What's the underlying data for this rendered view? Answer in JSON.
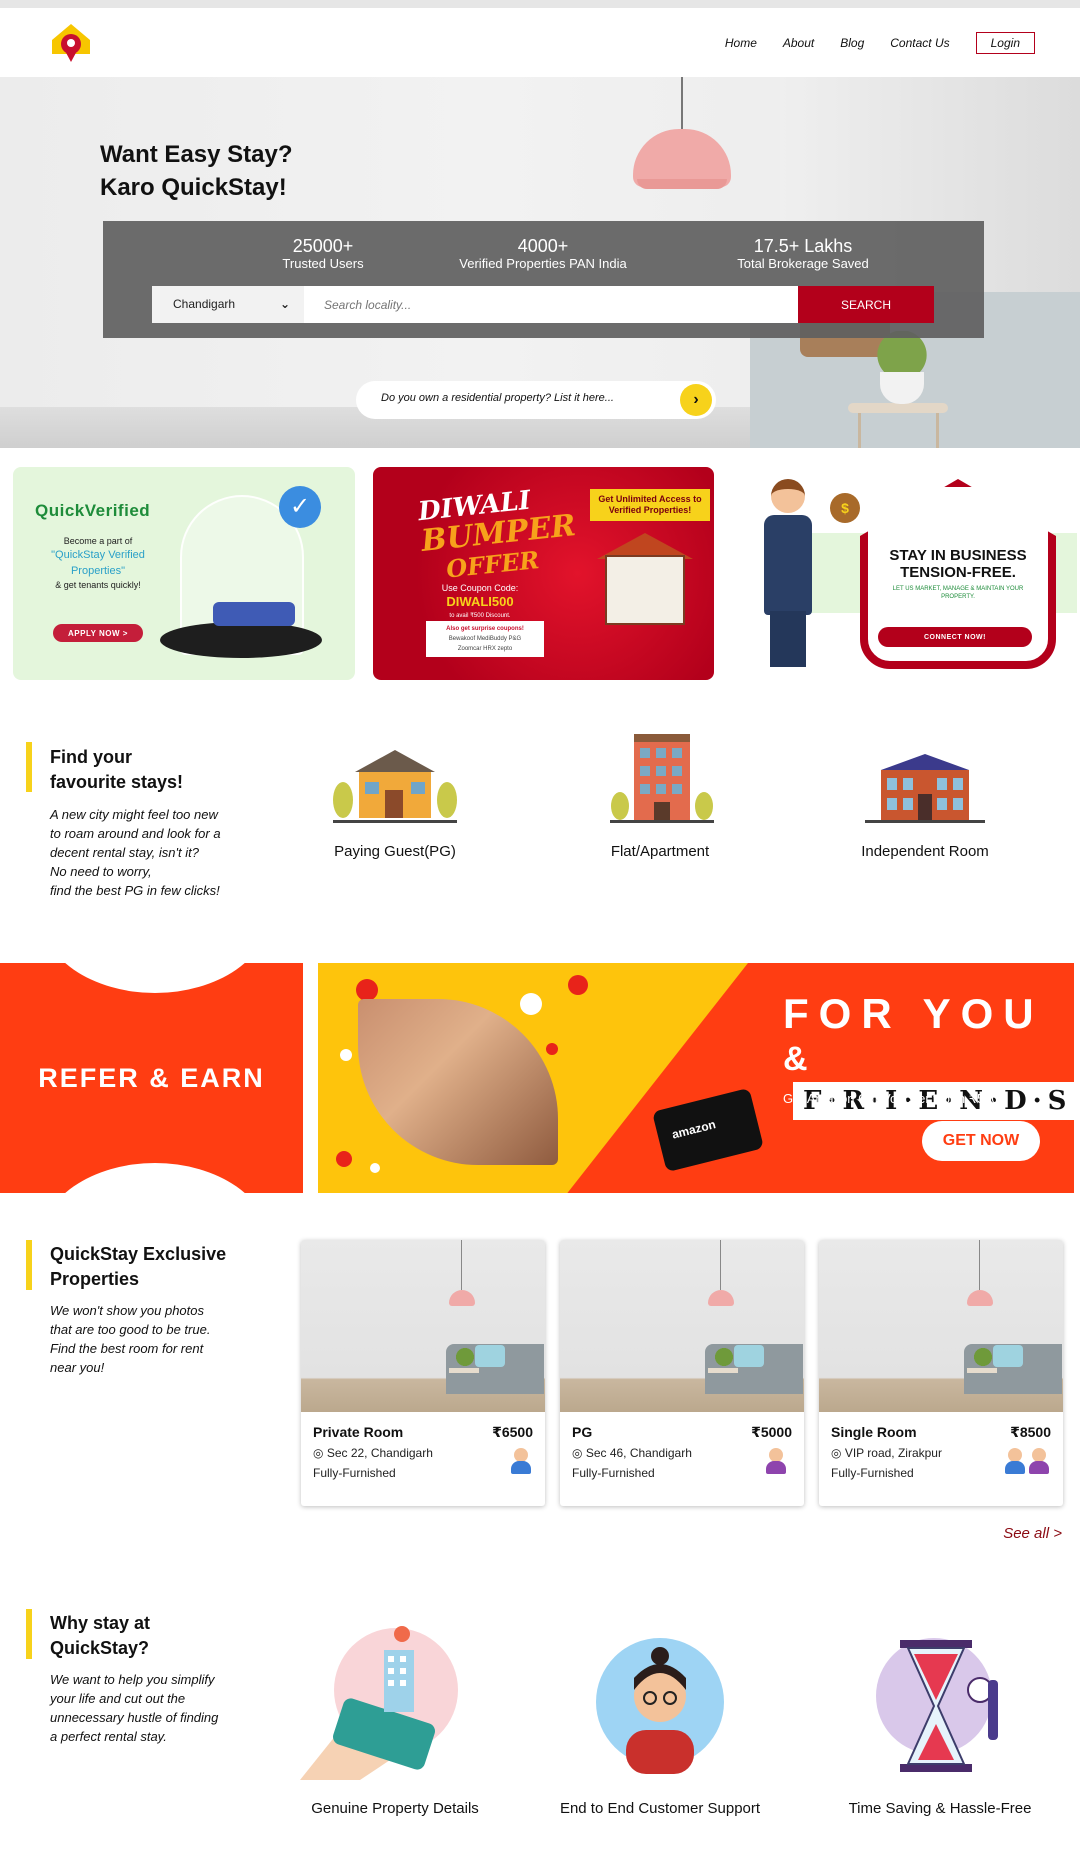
{
  "header": {
    "nav": [
      "Home",
      "About",
      "Blog",
      "Contact Us"
    ],
    "login_label": "Login"
  },
  "hero": {
    "title_line1": "Want Easy Stay?",
    "title_line2": "Karo QuickStay!",
    "stats": [
      {
        "number": "25000+",
        "label": "Trusted Users"
      },
      {
        "number": "4000+",
        "label": "Verified Properties PAN India"
      },
      {
        "number": "17.5+ Lakhs",
        "label": "Total Brokerage Saved"
      }
    ],
    "city": "Chandigarh",
    "locality_placeholder": "Search locality...",
    "search_label": "SEARCH",
    "list_prompt": "Do you own a residential property? List it here..."
  },
  "promos": {
    "verified": {
      "title": "QuickVerified",
      "line1": "Become a part of",
      "highlight": "\"QuickStay Verified Properties\"",
      "line2": "& get tenants quickly!",
      "button": "APPLY NOW >"
    },
    "diwali": {
      "title1": "DIWALI",
      "title2": "BUMPER",
      "title3": "OFFER",
      "access": "Get Unlimited Access to Verified Properties!",
      "coupon_label": "Use Coupon Code:",
      "coupon_code": "DIWALI500",
      "coupon_sub": "to avail ₹500 Discount.",
      "brands_label": "Also get surprise coupons!",
      "brands": [
        "Bewakoof",
        "MediBuddy",
        "P&G",
        "Zoomcar",
        "HRX",
        "zepto"
      ]
    },
    "business": {
      "title": "STAY IN BUSINESS TENSION-FREE.",
      "subtitle": "LET US MARKET, MANAGE & MAINTAIN YOUR PROPERTY.",
      "button": "CONNECT NOW!"
    }
  },
  "stays": {
    "title_line1": "Find your",
    "title_line2": "favourite stays!",
    "description": [
      "A new city might feel too new",
      "to roam around and look for a",
      "decent rental stay, isn't it?",
      "No need to worry,",
      "find the best PG in few clicks!"
    ],
    "categories": [
      "Paying Guest(PG)",
      "Flat/Apartment",
      "Independent Room"
    ]
  },
  "refer": {
    "left_text": "REFER & EARN",
    "for_you": "FOR YOU",
    "amp": "&",
    "friends": "F·R·I·E·N·D·S",
    "gift_text": "Get Amazon Gift Voucher worth ₹500!",
    "card_text": "amazon",
    "button": "GET NOW"
  },
  "exclusive": {
    "title_line1": "QuickStay Exclusive",
    "title_line2": "Properties",
    "description": [
      "We won't show you photos",
      "that are too good to be true.",
      "Find the best room for rent",
      "near you!"
    ],
    "properties": [
      {
        "type": "Private Room",
        "price": "₹6500",
        "location": "Sec 22, Chandigarh",
        "furnishing": "Fully-Furnished"
      },
      {
        "type": "PG",
        "price": "₹5000",
        "location": "Sec 46, Chandigarh",
        "furnishing": "Fully-Furnished"
      },
      {
        "type": "Single Room",
        "price": "₹8500",
        "location": "VIP road, Zirakpur",
        "furnishing": "Fully-Furnished"
      }
    ],
    "see_all": "See all >"
  },
  "why": {
    "title_line1": "Why stay at",
    "title_line2": "QuickStay?",
    "description": [
      "We want to help you simplify",
      "your life and cut out the",
      "unnecessary hustle of finding",
      "a perfect rental stay."
    ],
    "features": [
      "Genuine Property Details",
      "End to End Customer Support",
      "Time Saving & Hassle-Free"
    ]
  },
  "colors": {
    "brand_red": "#b3001b",
    "accent_yellow": "#f7d21b",
    "refer_orange": "#ff3d12"
  }
}
